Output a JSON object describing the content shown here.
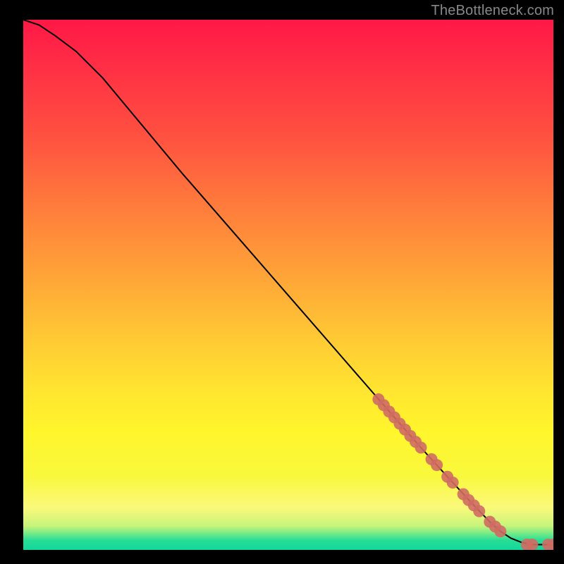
{
  "watermark": "TheBottleneck.com",
  "colors": {
    "point_fill": "#cf6c63",
    "curve_stroke": "#000000"
  },
  "chart_data": {
    "type": "line",
    "title": "",
    "xlabel": "",
    "ylabel": "",
    "xlim": [
      0,
      100
    ],
    "ylim": [
      0,
      100
    ],
    "curve": {
      "x": [
        0,
        3,
        6,
        10,
        15,
        20,
        30,
        40,
        50,
        60,
        70,
        75,
        80,
        85,
        88,
        90,
        92,
        94,
        96,
        98,
        100
      ],
      "y": [
        100,
        99,
        97,
        94,
        89,
        83,
        71,
        59.5,
        48,
        36.5,
        25,
        19.3,
        13.8,
        8.4,
        5.3,
        3.5,
        2.2,
        1.4,
        1.0,
        1.0,
        1.0
      ]
    },
    "series": [
      {
        "name": "dots",
        "x": [
          67,
          68,
          69,
          70,
          71,
          72,
          73,
          74,
          75,
          77,
          78,
          80,
          81,
          83,
          84,
          85,
          86,
          88,
          89,
          90,
          95,
          96,
          99,
          100
        ],
        "y": [
          28.4,
          27.3,
          26.1,
          25.0,
          23.8,
          22.7,
          21.5,
          20.4,
          19.3,
          17.1,
          16.0,
          13.8,
          12.7,
          10.5,
          9.4,
          8.4,
          7.3,
          5.3,
          4.4,
          3.5,
          1.0,
          1.0,
          1.0,
          1.0
        ]
      }
    ]
  }
}
